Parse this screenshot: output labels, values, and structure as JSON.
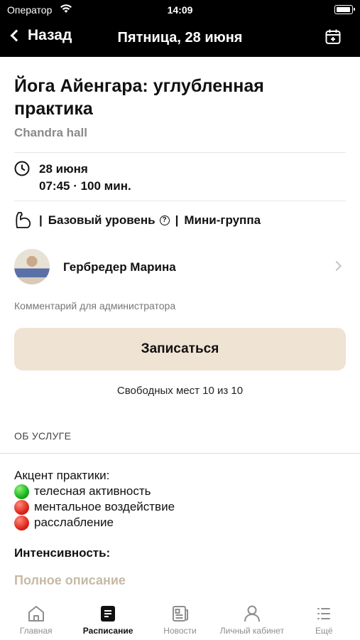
{
  "status_bar": {
    "carrier": "Оператор",
    "time": "14:09"
  },
  "nav": {
    "back_label": "Назад",
    "title": "Пятница, 28 июня",
    "calendar_icon": "calendar-add-icon"
  },
  "class": {
    "title": "Йога Айенгара: углубленная практика",
    "hall": "Chandra hall",
    "date": "28 июня",
    "time_duration": "07:45 · 100 мин.",
    "level": "Базовый уровень",
    "level_info_glyph": "?",
    "separator": "|",
    "group": "Мини-группа"
  },
  "trainer": {
    "name": "Гербредер Марина"
  },
  "comment": "Комментарий для администратора",
  "signup_button": "Записаться",
  "seats": "Свободных мест 10 из 10",
  "about": {
    "section_title": "ОБ УСЛУГЕ",
    "accent_heading": "Акцент практики:",
    "accents": [
      {
        "text": "телесная активность",
        "color": "green"
      },
      {
        "text": "ментальное воздействие",
        "color": "red"
      },
      {
        "text": "расслабление",
        "color": "red"
      }
    ],
    "intensity": "Интенсивность:",
    "full_description": "Полное описание"
  },
  "tabs": [
    {
      "label": "Главная",
      "icon": "home-icon",
      "active": false
    },
    {
      "label": "Расписание",
      "icon": "schedule-icon",
      "active": true
    },
    {
      "label": "Новости",
      "icon": "news-icon",
      "active": false
    },
    {
      "label": "Личный кабинет",
      "icon": "profile-icon",
      "active": false
    },
    {
      "label": "Ещё",
      "icon": "more-list-icon",
      "active": false
    }
  ]
}
